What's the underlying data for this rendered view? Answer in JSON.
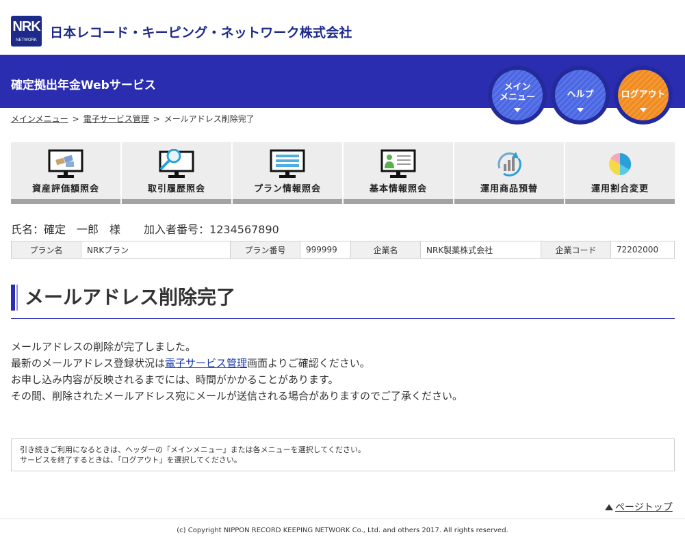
{
  "header": {
    "logo_main": "NRK",
    "logo_sub": "NETWORK",
    "company_name": "日本レコード・キーピング・ネットワーク株式会社"
  },
  "service_bar": {
    "title": "確定拠出年金Webサービス",
    "nav_buttons": [
      {
        "label": "メイン\nメニュー",
        "color": "#4b66e0"
      },
      {
        "label": "ヘルプ",
        "color": "#4b66e0"
      },
      {
        "label": "ログアウト",
        "color": "#f08a20"
      }
    ]
  },
  "breadcrumb": {
    "items": [
      "メインメニュー",
      "電子サービス管理",
      "メールアドレス削除完了"
    ],
    "separator": ">"
  },
  "menu_tiles": [
    {
      "label": "資産評価額照会",
      "icon": "asset-monitor-icon"
    },
    {
      "label": "取引履歴照会",
      "icon": "search-monitor-icon"
    },
    {
      "label": "プラン情報照会",
      "icon": "plan-monitor-icon"
    },
    {
      "label": "基本情報照会",
      "icon": "profile-monitor-icon"
    },
    {
      "label": "運用商品預替",
      "icon": "switch-chart-icon"
    },
    {
      "label": "運用割合変更",
      "icon": "pie-chart-icon"
    }
  ],
  "user": {
    "name_label": "氏名：",
    "name": "確定　一郎　様",
    "member_label": "加入者番号：",
    "member_no": "1234567890"
  },
  "info_table": {
    "plan_name_label": "プラン名",
    "plan_name": "NRKプラン",
    "plan_no_label": "プラン番号",
    "plan_no": "999999",
    "company_label": "企業名",
    "company": "NRK製薬株式会社",
    "company_code_label": "企業コード",
    "company_code": "72202000"
  },
  "page_title": "メールアドレス削除完了",
  "message": {
    "line1": "メールアドレスの削除が完了しました。",
    "line2_pre": "最新のメールアドレス登録状況は",
    "line2_link": "電子サービス管理",
    "line2_post": "画面よりご確認ください。",
    "line3": "お申し込み内容が反映されるまでには、時間がかかることがあります。",
    "line4": "その間、削除されたメールアドレス宛にメールが送信される場合がありますのでご了承ください。"
  },
  "note": {
    "line1": "引き続きご利用になるときは、ヘッダーの「メインメニュー」または各メニューを選択してください。",
    "line2": "サービスを終了するときは、「ログアウト」を選択してください。"
  },
  "page_top_label": "ページトップ",
  "copyright": "(c) Copyright NIPPON RECORD KEEPING NETWORK Co., Ltd. and others 2017. All rights reserved.",
  "colors": {
    "brand_blue": "#2b2db0",
    "logout_orange": "#f08a20",
    "tile_bg": "#ededed"
  }
}
